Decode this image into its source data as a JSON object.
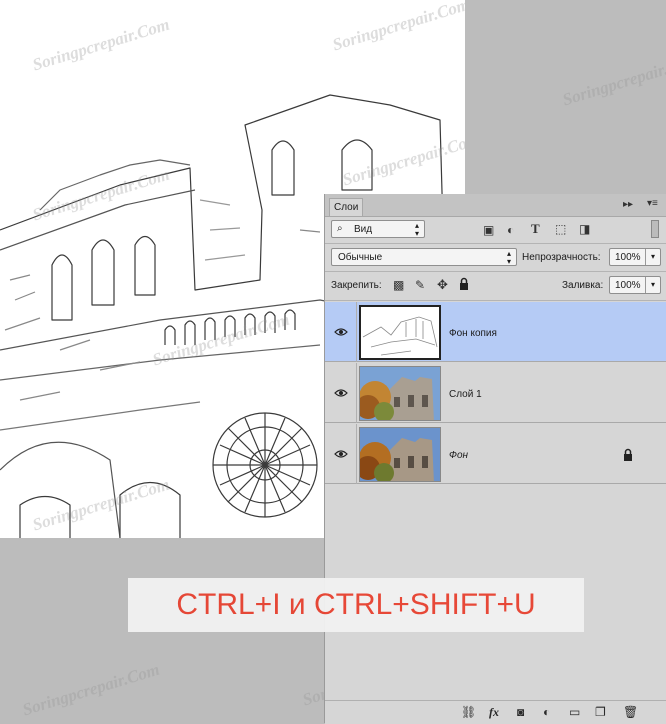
{
  "canvas": {
    "watermark": "Soringpcrepair.Com"
  },
  "layers_panel": {
    "tab_label": "Слои",
    "filter": {
      "kind_label": "Вид"
    },
    "blend_mode": "Обычные",
    "opacity": {
      "label": "Непрозрачность:",
      "value": "100%"
    },
    "lock": {
      "label": "Закрепить:"
    },
    "fill": {
      "label": "Заливка:",
      "value": "100%"
    },
    "layers": [
      {
        "name": "Фон копия",
        "selected": true,
        "locked": false,
        "italic": false
      },
      {
        "name": "Слой 1",
        "selected": false,
        "locked": false,
        "italic": false
      },
      {
        "name": "Фон",
        "selected": false,
        "locked": true,
        "italic": true
      }
    ]
  },
  "caption": {
    "text": "CTRL+I и CTRL+SHIFT+U"
  },
  "colors": {
    "selection": "#b5cbf5",
    "caption_text": "#e8412f",
    "panel_bg": "#d6d6d6",
    "workspace_bg": "#bcbcbc"
  },
  "icons": [
    "search-icon",
    "image-filter-icon",
    "adjustment-filter-icon",
    "type-filter-icon",
    "shape-filter-icon",
    "smart-object-filter-icon",
    "filter-toggle-icon",
    "collapse-icon",
    "panel-menu-icon",
    "lock-pixels-icon",
    "lock-brush-icon",
    "lock-position-icon",
    "lock-all-icon",
    "eye-icon",
    "lock-icon",
    "link-icon",
    "fx-icon",
    "mask-icon",
    "adjustment-icon",
    "folder-icon",
    "new-layer-icon",
    "trash-icon"
  ]
}
